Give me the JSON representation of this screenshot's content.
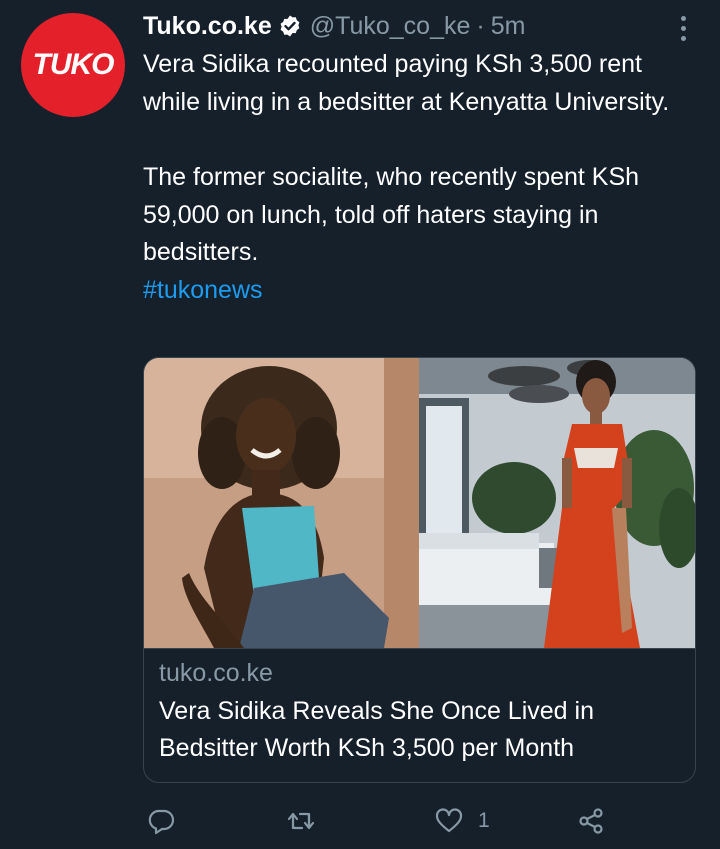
{
  "tweet": {
    "avatar_text": "TUKO",
    "name": "Tuko.co.ke",
    "handle": "@Tuko_co_ke",
    "separator": "·",
    "time": "5m",
    "paragraph1": "Vera Sidika recounted paying KSh 3,500 rent while living in a bedsitter at Kenyatta University.",
    "paragraph2": "The former socialite, who recently spent KSh 59,000 on lunch, told off haters staying in bedsitters.",
    "hashtag": "#tukonews"
  },
  "card": {
    "domain": "tuko.co.ke",
    "title": "Vera Sidika Reveals She Once Lived in Bedsitter Worth KSh 3,500 per Month"
  },
  "actions": {
    "like_count": "1"
  },
  "colors": {
    "background": "#15202b",
    "secondary_text": "#8899a6",
    "link": "#1d9bf0",
    "brand": "#e4212b",
    "dress": "#d4421d"
  }
}
